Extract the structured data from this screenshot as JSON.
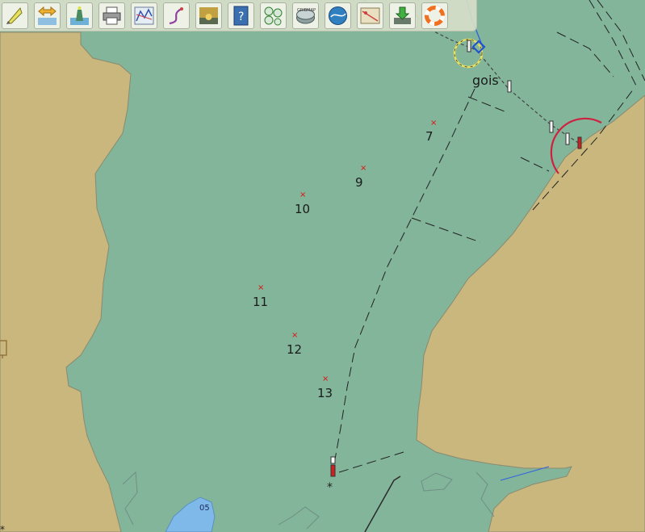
{
  "toolbar": {
    "tools": [
      {
        "name": "navobj-tool",
        "icon": "pencil-triangle-icon"
      },
      {
        "name": "zoom-tool",
        "icon": "double-arrow-icon"
      },
      {
        "name": "lighthouse-tool",
        "icon": "lighthouse-icon"
      },
      {
        "name": "print-tool",
        "icon": "printer-icon"
      },
      {
        "name": "route-manager-tool",
        "icon": "route-graph-icon"
      },
      {
        "name": "track-tool",
        "icon": "track-curve-icon"
      },
      {
        "name": "sunset-tool",
        "icon": "sunset-icon"
      },
      {
        "name": "help-tool",
        "icon": "help-book-icon"
      },
      {
        "name": "dashboard-tool",
        "icon": "gauges-icon"
      },
      {
        "name": "grib-tool",
        "icon": "grib-icon",
        "label": "GRIBMAP"
      },
      {
        "name": "globe-tool",
        "icon": "globe-icon"
      },
      {
        "name": "weather-routing-tool",
        "icon": "weather-map-icon"
      },
      {
        "name": "download-tool",
        "icon": "download-icon"
      },
      {
        "name": "lifebuoy-tool",
        "icon": "lifebuoy-icon"
      }
    ]
  },
  "map": {
    "route_name": "gois",
    "waypoints": [
      {
        "label": "7"
      },
      {
        "label": "9"
      },
      {
        "label": "10"
      },
      {
        "label": "11"
      },
      {
        "label": "12"
      },
      {
        "label": "13"
      }
    ],
    "sounding": "05",
    "colors": {
      "water": "#82b59a",
      "land": "#c9b77d",
      "shallow": "#7fb9ea",
      "waypoint": "#e01010",
      "arc": "#d02040"
    }
  }
}
